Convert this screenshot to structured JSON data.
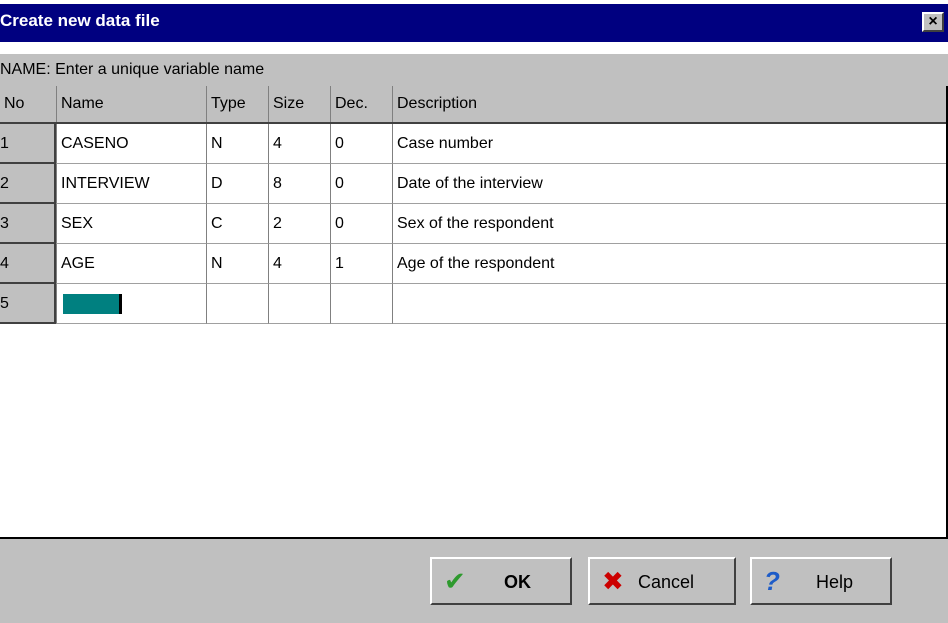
{
  "window": {
    "title": "Create new data file",
    "close_label": "×"
  },
  "hint": "NAME: Enter a unique variable name",
  "columns": [
    "No",
    "Name",
    "Type",
    "Size",
    "Dec.",
    "Description"
  ],
  "rows": [
    {
      "no": "1",
      "name": "CASENO",
      "type": "N",
      "size": "4",
      "dec": "0",
      "description": "Case number"
    },
    {
      "no": "2",
      "name": "INTERVIEW",
      "type": "D",
      "size": "8",
      "dec": "0",
      "description": "Date of the interview"
    },
    {
      "no": "3",
      "name": "SEX",
      "type": "C",
      "size": "2",
      "dec": "0",
      "description": "Sex of the respondent"
    },
    {
      "no": "4",
      "name": "AGE",
      "type": "N",
      "size": "4",
      "dec": "1",
      "description": "Age of the respondent"
    },
    {
      "no": "5",
      "name": "",
      "type": "",
      "size": "",
      "dec": "",
      "description": ""
    }
  ],
  "buttons": {
    "ok": {
      "label": "OK",
      "icon": "checkmark-icon"
    },
    "cancel": {
      "label": "Cancel",
      "icon": "x-icon"
    },
    "help": {
      "label": "Help",
      "icon": "question-icon"
    }
  },
  "colors": {
    "title_bar": "#000080",
    "face": "#c0c0c0",
    "edit_cell": "#008080",
    "ok_check": "#2e9a2e",
    "cancel_x": "#cc0000",
    "help_q": "#1e5cc8"
  }
}
